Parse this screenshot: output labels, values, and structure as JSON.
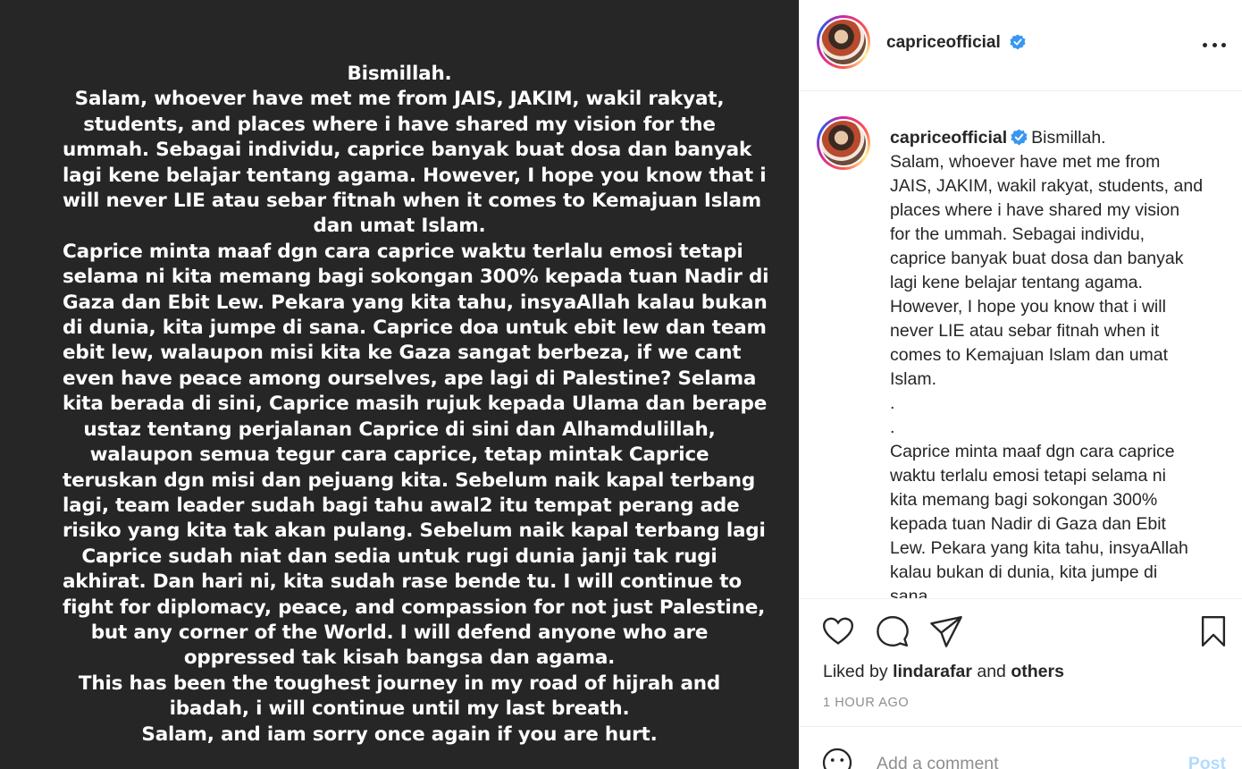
{
  "post_image": {
    "lines": [
      "Bismillah.",
      "Salam, whoever have met me from JAIS, JAKIM, wakil rakyat,",
      "students, and places where i have shared my vision for the",
      "ummah. Sebagai individu, caprice banyak buat dosa dan banyak",
      "lagi kene belajar tentang agama. However, I hope you know that i",
      "will never LIE atau sebar fitnah when it comes to Kemajuan Islam",
      "dan umat Islam.",
      "Caprice minta maaf dgn cara caprice waktu terlalu emosi tetapi",
      "selama ni kita memang bagi sokongan 300% kepada tuan Nadir di",
      "Gaza dan Ebit Lew. Pekara yang kita tahu, insyaAllah kalau bukan",
      "di dunia, kita jumpe di sana. Caprice doa untuk ebit lew dan team",
      "ebit lew, walaupon misi kita ke Gaza sangat berbeza, if we cant",
      "even have peace among ourselves, ape lagi di Palestine? Selama",
      "kita berada di sini, Caprice masih rujuk kepada Ulama dan berape",
      "ustaz tentang perjalanan Caprice di sini dan Alhamdulillah,",
      "walaupon semua tegur cara caprice, tetap mintak Caprice",
      "teruskan dgn misi dan pejuang kita. Sebelum naik kapal terbang",
      "lagi, team leader sudah bagi tahu awal2 itu tempat perang ade",
      "risiko yang kita tak akan pulang. Sebelum naik kapal terbang lagi",
      "Caprice sudah niat dan sedia untuk rugi dunia janji tak rugi",
      "akhirat. Dan hari ni, kita sudah rase bende tu. I will continue to",
      "fight for diplomacy, peace, and compassion for not just Palestine,",
      "but any corner of the World. I will defend anyone who are",
      "oppressed tak kisah bangsa dan agama.",
      "This has been the toughest journey in my road of hijrah and",
      "ibadah, i will continue until my last breath.",
      "Salam, and iam sorry once again if you are hurt."
    ]
  },
  "header": {
    "username": "capriceofficial",
    "avatar_icon": "profile-photo",
    "verified_icon": "verified-badge-icon",
    "more_icon": "more-options-icon"
  },
  "caption": {
    "username": "capriceofficial",
    "first_text": "Bismillah.",
    "lines": [
      "Salam, whoever have met me from",
      "JAIS, JAKIM, wakil rakyat, students, and",
      "places where i have shared my vision",
      "for the ummah. Sebagai individu,",
      "caprice banyak buat dosa dan banyak",
      "lagi kene belajar tentang agama.",
      "However, I hope you know that i will",
      "never LIE atau sebar fitnah when it",
      "comes to Kemajuan Islam dan umat",
      "Islam.",
      ".",
      ".",
      "Caprice minta maaf dgn cara caprice",
      "waktu terlalu emosi tetapi selama ni",
      "kita memang bagi sokongan 300%",
      "kepada tuan Nadir di Gaza dan Ebit",
      "Lew. Pekara yang kita tahu, insyaAllah",
      "kalau bukan di dunia, kita jumpe di",
      "sana."
    ]
  },
  "actions": {
    "liked_prefix": "Liked by ",
    "liked_user": "lindarafar",
    "liked_and": " and ",
    "liked_others": "others",
    "timestamp": "1 HOUR AGO"
  },
  "comment": {
    "placeholder": "Add a comment",
    "post_label": "Post"
  },
  "colors": {
    "image_background": "#262626",
    "verified_blue": "#3897f0",
    "post_button_disabled": "#b3dbff",
    "muted_text": "#8e8e8e"
  }
}
